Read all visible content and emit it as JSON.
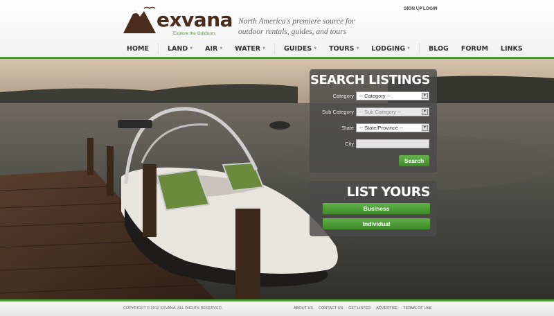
{
  "brand": {
    "name": "exvana",
    "tagline_small": "Explore the Outdoors",
    "tagline": "North America's premiere source for outdoor rentals, guides, and tours"
  },
  "auth": {
    "signup": "SIGN UP",
    "login": "LOGIN"
  },
  "nav": {
    "home": "HOME",
    "land": "LAND",
    "air": "AIR",
    "water": "WATER",
    "guides": "GUIDES",
    "tours": "TOURS",
    "lodging": "LODGING",
    "blog": "BLOG",
    "forum": "FORUM",
    "links": "LINKS",
    "caret": "▼"
  },
  "search": {
    "title": "SEARCH LISTINGS",
    "category_label": "Category",
    "category_value": "-- Category --",
    "subcategory_label": "Sub Category",
    "subcategory_value": "-- Sub Category --",
    "state_label": "State",
    "state_value": "-- State/Province --",
    "city_label": "City",
    "button": "Search"
  },
  "list": {
    "title": "LIST YOURS",
    "business": "Business",
    "individual": "Individual"
  },
  "footer": {
    "copyright": "COPYRIGHT © 2012 EXVANA. ALL RIGHTS RESERVED.",
    "links": [
      "ABOUT US",
      "CONTACT US",
      "GET LISTED",
      "ADVERTISE",
      "TERMS OF USE"
    ]
  },
  "colors": {
    "accent": "#4e9a3a",
    "brand_brown": "#4a2d1b",
    "panel": "#4b4b4b"
  }
}
